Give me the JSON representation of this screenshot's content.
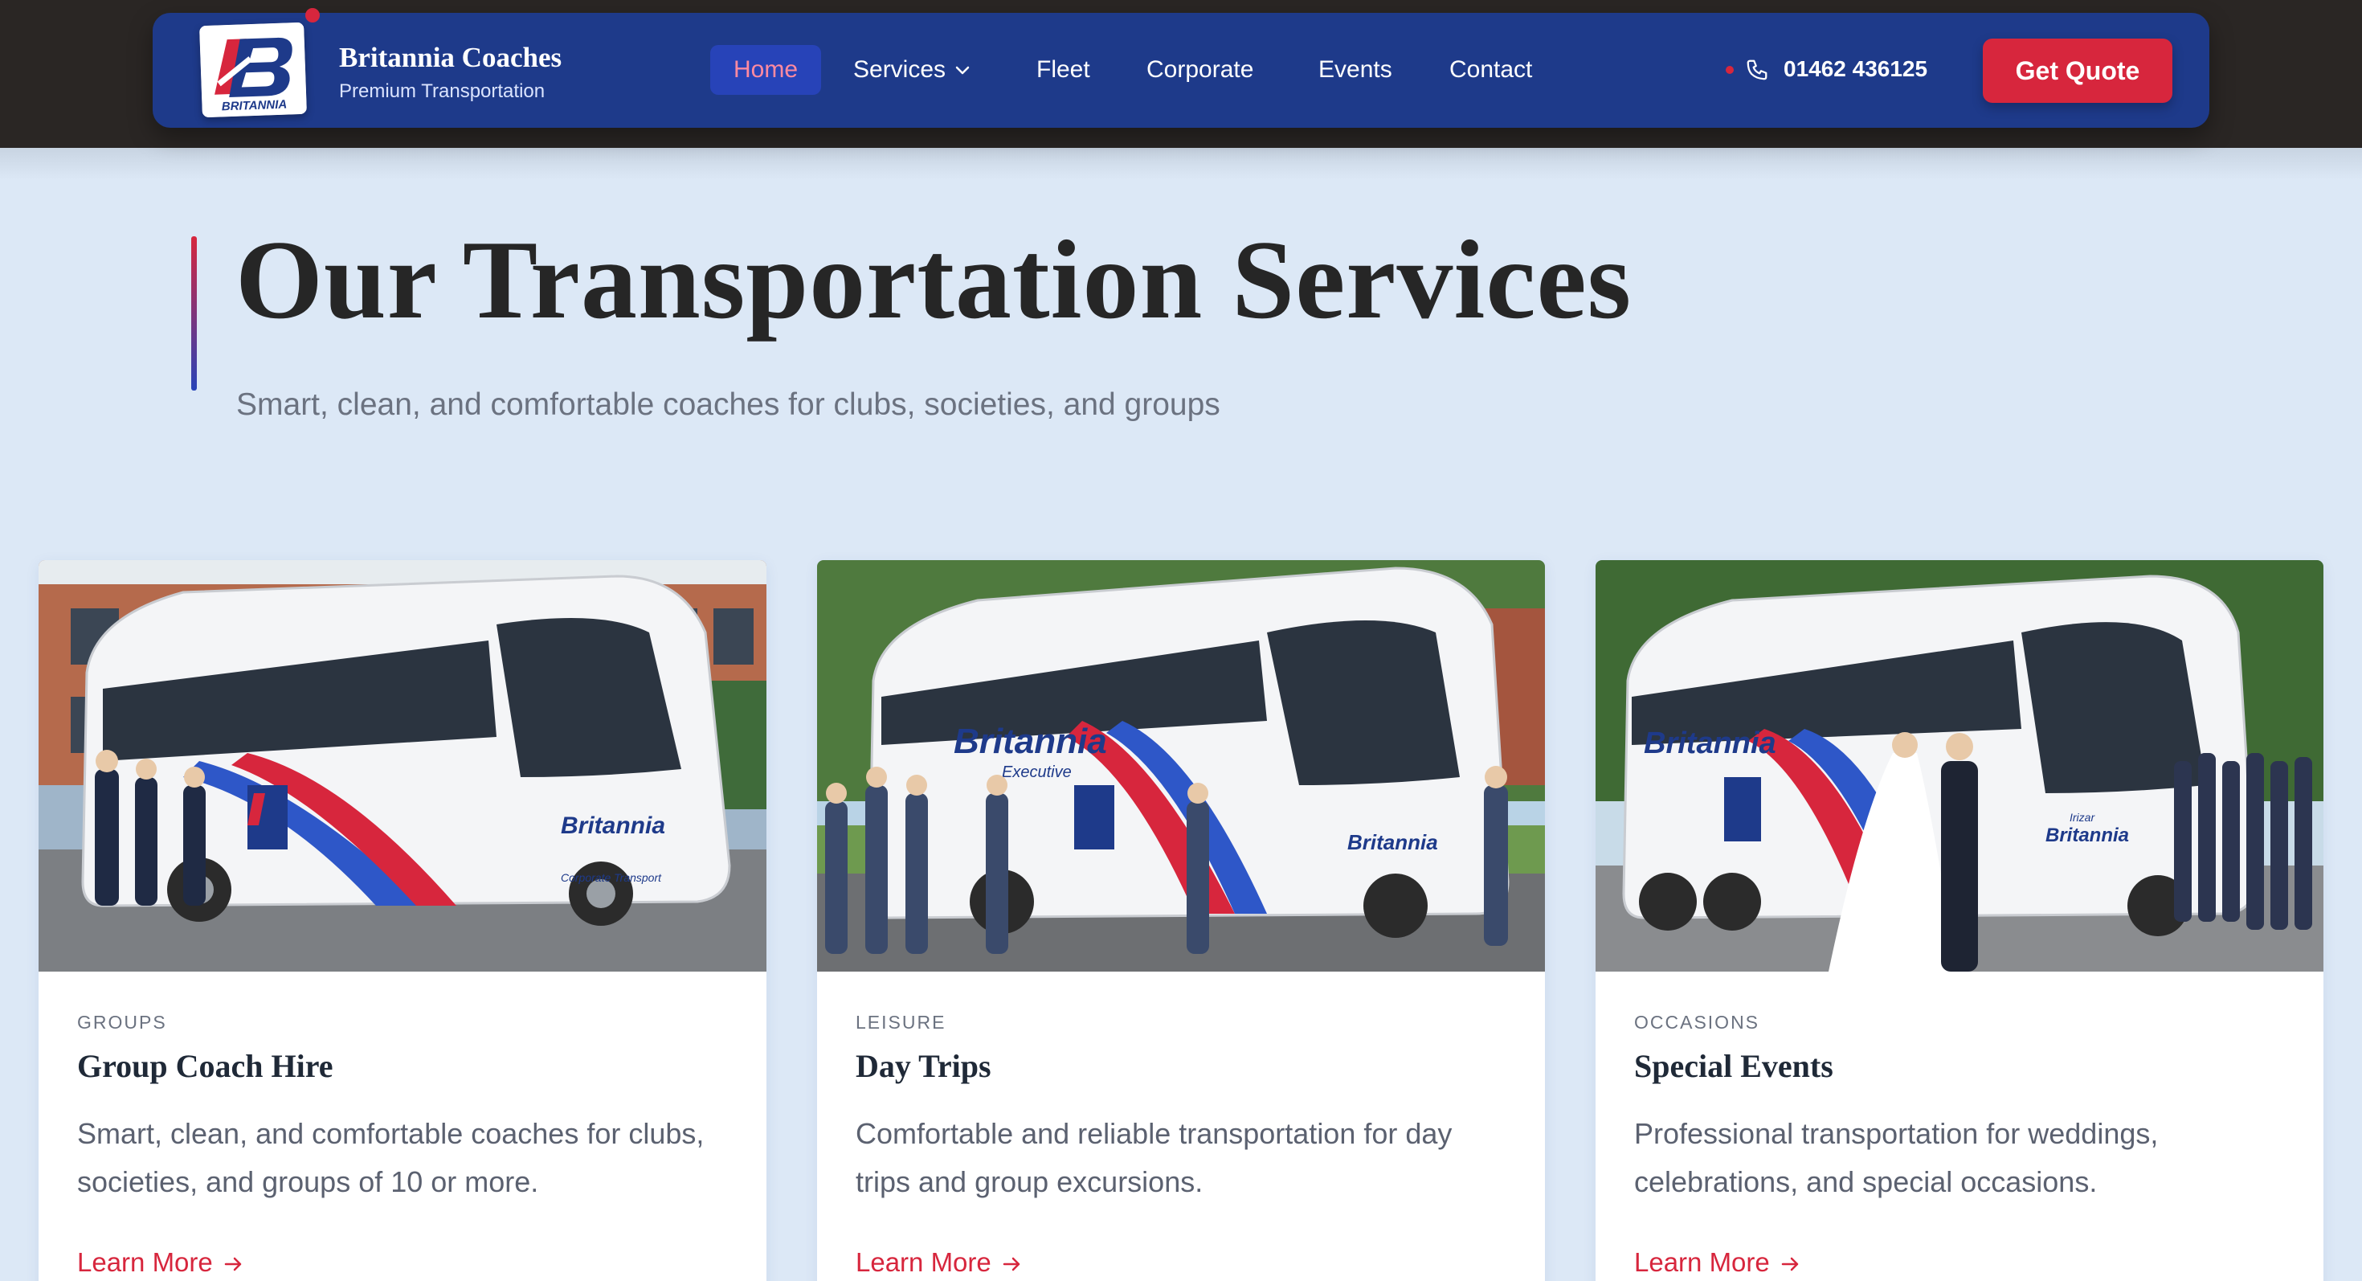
{
  "brand": {
    "name": "Britannia Coaches",
    "tagline": "Premium Transportation",
    "logo_text": "BRITANNIA",
    "logo_letter": "B"
  },
  "nav": {
    "items": [
      {
        "label": "Home",
        "active": true
      },
      {
        "label": "Services",
        "has_dropdown": true
      },
      {
        "label": "Fleet"
      },
      {
        "label": "Corporate"
      },
      {
        "label": "Events"
      },
      {
        "label": "Contact"
      }
    ],
    "phone": "01462 436125",
    "cta": "Get Quote"
  },
  "hero": {
    "title": "Our Transportation Services",
    "subtitle": "Smart, clean, and comfortable coaches for clubs, societies, and groups"
  },
  "cards": [
    {
      "tag": "GROUPS",
      "title": "Group Coach Hire",
      "description": "Smart, clean, and comfortable coaches for clubs, societies, and groups of 10 or more.",
      "link": "Learn More",
      "bus_text": "Britannia",
      "bus_subtext": "Corporate Transport"
    },
    {
      "tag": "LEISURE",
      "title": "Day Trips",
      "description": "Comfortable and reliable transportation for day trips and group excursions.",
      "link": "Learn More",
      "bus_text": "Britannia",
      "bus_subtext": "Executive"
    },
    {
      "tag": "OCCASIONS",
      "title": "Special Events",
      "description": "Professional transportation for weddings, celebrations, and special occasions.",
      "link": "Learn More",
      "bus_text": "Britannia",
      "bus_subtext": "Irizar"
    }
  ],
  "colors": {
    "navy": "#1e3a8a",
    "red": "#d7263d",
    "background": "#dce8f6"
  },
  "icons": {
    "phone": "phone-icon",
    "dropdown": "chevron-down-icon",
    "link_arrow": "arrow-right-icon"
  }
}
